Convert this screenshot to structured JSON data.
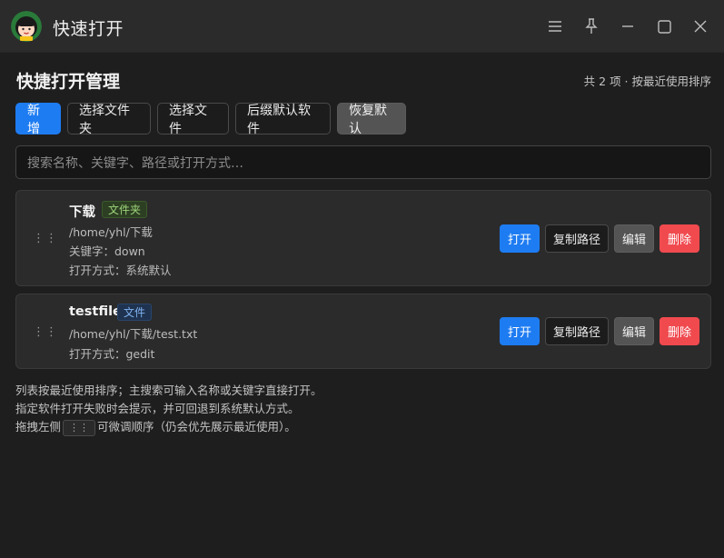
{
  "window": {
    "title": "快速打开",
    "controls": [
      "menu-icon",
      "pin-icon",
      "minimize-icon",
      "maximize-icon",
      "close-icon"
    ]
  },
  "header": {
    "title": "快捷打开管理",
    "count_text": "共 2 项 · 按最近使用排序"
  },
  "toolbar": {
    "add_label": "新增",
    "select_folder_label": "选择文件夹",
    "select_file_label": "选择文件",
    "suffix_default_label": "后缀默认软件",
    "restore_default_label": "恢复默认"
  },
  "search": {
    "placeholder": "搜索名称、关键字、路径或打开方式…"
  },
  "items": [
    {
      "name": "下载",
      "tag": "文件夹",
      "path": "/home/yhl/下载",
      "keyword": "关键字：down",
      "open_with": "打开方式：系统默认"
    },
    {
      "name": "testfile",
      "tag": "文件",
      "path": "/home/yhl/下载/test.txt",
      "open_with": "打开方式：gedit"
    }
  ],
  "actions": {
    "open": "打开",
    "copy_path": "复制路径",
    "edit": "编辑",
    "delete": "删除"
  },
  "drag_handle_glyph": "⋮⋮",
  "footer": {
    "line1": "列表按最近使用排序；主搜索可输入名称或关键字直接打开。",
    "line2": "指定软件打开失败时会提示，并可回退到系统默认方式。",
    "line3_prefix": "拖拽左侧",
    "line3_kbd": "⋮⋮",
    "line3_suffix": "可微调顺序（仍会优先展示最近使用）。"
  },
  "colors": {
    "accent": "#1e7cf2",
    "danger": "#f04a4f",
    "background": "#1e1e1e",
    "card": "#2b2b2b"
  }
}
